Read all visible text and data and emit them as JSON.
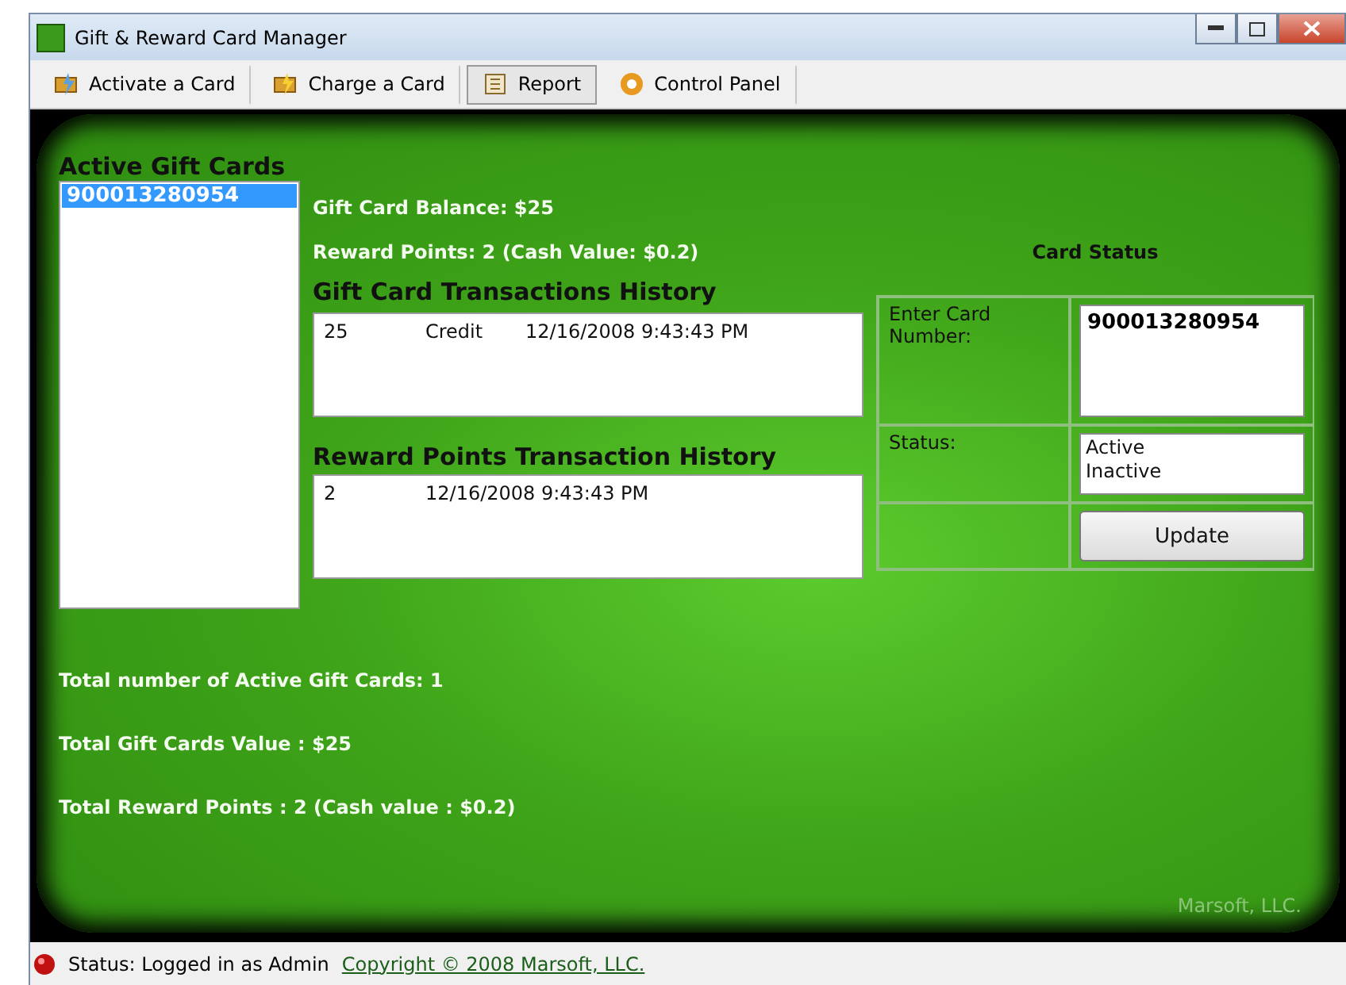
{
  "window": {
    "title": "Gift & Reward Card Manager"
  },
  "tabs": [
    {
      "label": "Activate a Card",
      "selected": false
    },
    {
      "label": "Charge a Card",
      "selected": false
    },
    {
      "label": "Report",
      "selected": true
    },
    {
      "label": "Control Panel",
      "selected": false
    }
  ],
  "active_cards": {
    "title": "Active Gift Cards",
    "items": [
      {
        "label": "900013280954",
        "selected": true
      }
    ]
  },
  "balance": "Gift Card Balance: $25",
  "reward_points": "Reward Points: 2 (Cash Value: $0.2)",
  "gift_history": {
    "title": "Gift Card Transactions History",
    "rows": [
      {
        "amount": "25",
        "type": "Credit",
        "date": "12/16/2008 9:43:43 PM"
      }
    ]
  },
  "reward_history": {
    "title": "Reward Points Transaction History",
    "rows": [
      {
        "points": "2",
        "date": "12/16/2008 9:43:43 PM"
      }
    ]
  },
  "card_status": {
    "title": "Card Status",
    "card_label": "Enter Card Number:",
    "card_value": "900013280954",
    "status_label": "Status:",
    "status_options": [
      {
        "label": "Active",
        "selected": false
      },
      {
        "label": "Inactive",
        "selected": false
      }
    ],
    "button": "Update"
  },
  "totals": [
    "Total number of Active Gift Cards: 1",
    "Total Gift Cards Value : $25",
    "Total Reward Points : 2 (Cash value : $0.2)"
  ],
  "brand": "Marsoft,  LLC.",
  "status_bar": {
    "status": "Status: Logged in as Admin",
    "link": "Copyright © 2008 Marsoft, LLC."
  }
}
